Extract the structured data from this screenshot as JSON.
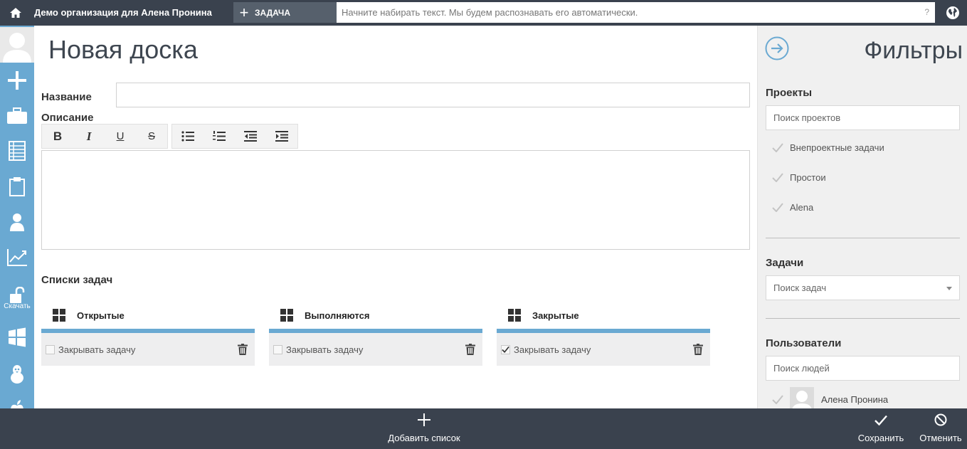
{
  "topbar": {
    "org_title": "Демо организация для Алена Пронина",
    "task_button_label": "ЗАДАЧА",
    "search_placeholder": "Начните набирать текст. Мы будем распознавать его автоматически.",
    "search_help": "?"
  },
  "sidebar": {
    "items": [
      {
        "icon": "plus-icon"
      },
      {
        "icon": "briefcase-icon"
      },
      {
        "icon": "spreadsheet-icon"
      },
      {
        "icon": "clipboard-icon"
      },
      {
        "icon": "person-icon"
      },
      {
        "icon": "chart-icon"
      },
      {
        "icon": "unlock-icon",
        "caption": "Скачать"
      },
      {
        "icon": "windows-icon"
      },
      {
        "icon": "linux-icon"
      },
      {
        "icon": "apple-icon"
      }
    ]
  },
  "main": {
    "title": "Новая доска",
    "name_label": "Название",
    "name_value": "",
    "description_label": "Описание",
    "description_value": "",
    "toolbar": [
      "bold",
      "italic",
      "underline",
      "strikethrough",
      "bullet-list",
      "numbered-list",
      "outdent",
      "indent"
    ],
    "toolbar_glyphs": {
      "bold": "B",
      "italic": "I",
      "underline": "U",
      "strikethrough": "S"
    },
    "lists_label": "Списки задач",
    "lists": [
      {
        "title": "Открытые",
        "close_label": "Закрывать задачу",
        "checked": false
      },
      {
        "title": "Выполняются",
        "close_label": "Закрывать задачу",
        "checked": false
      },
      {
        "title": "Закрытые",
        "close_label": "Закрывать задачу",
        "checked": true
      }
    ]
  },
  "filters": {
    "title": "Фильтры",
    "projects": {
      "label": "Проекты",
      "placeholder": "Поиск проектов",
      "items": [
        "Внепроектные задачи",
        "Простои",
        "Alena"
      ]
    },
    "tasks": {
      "label": "Задачи",
      "placeholder": "Поиск задач"
    },
    "users": {
      "label": "Пользователи",
      "placeholder": "Поиск людей",
      "items": [
        "Алена Пронина"
      ]
    }
  },
  "bottombar": {
    "add_list_label": "Добавить список",
    "save_label": "Сохранить",
    "cancel_label": "Отменить"
  },
  "colors": {
    "topbar": "#3a424e",
    "sidebar": "#6aa9d2",
    "accent": "#6aa9d2"
  }
}
